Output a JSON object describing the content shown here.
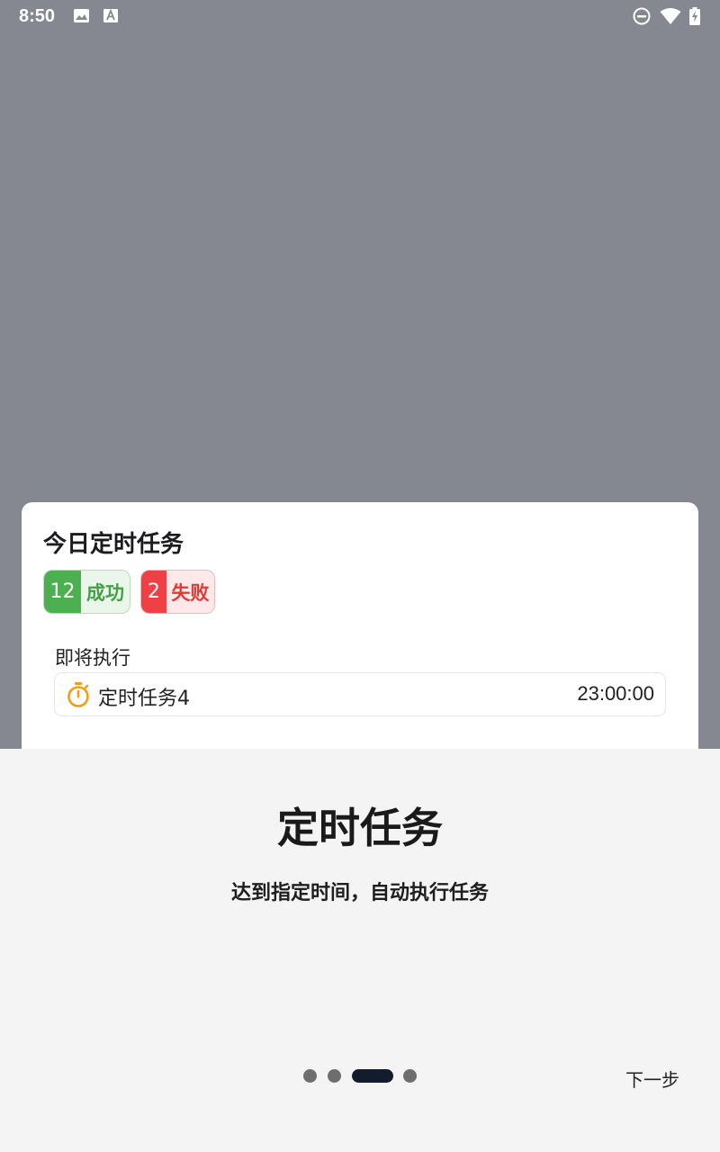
{
  "status_bar": {
    "time": "8:50"
  },
  "card": {
    "title": "今日定时任务",
    "success": {
      "count": "12",
      "label": "成功",
      "color": "#4caf50"
    },
    "fail": {
      "count": "2",
      "label": "失败",
      "color": "#ef4046"
    },
    "upcoming_label": "即将执行",
    "task": {
      "name": "定时任务4",
      "time": "23:00:00",
      "icon": "timer-icon",
      "icon_color": "#f39c12"
    }
  },
  "onboarding": {
    "title": "定时任务",
    "subtitle": "达到指定时间，自动执行任务",
    "page_indicator": {
      "total": 4,
      "current": 3
    },
    "next_label": "下一步"
  }
}
